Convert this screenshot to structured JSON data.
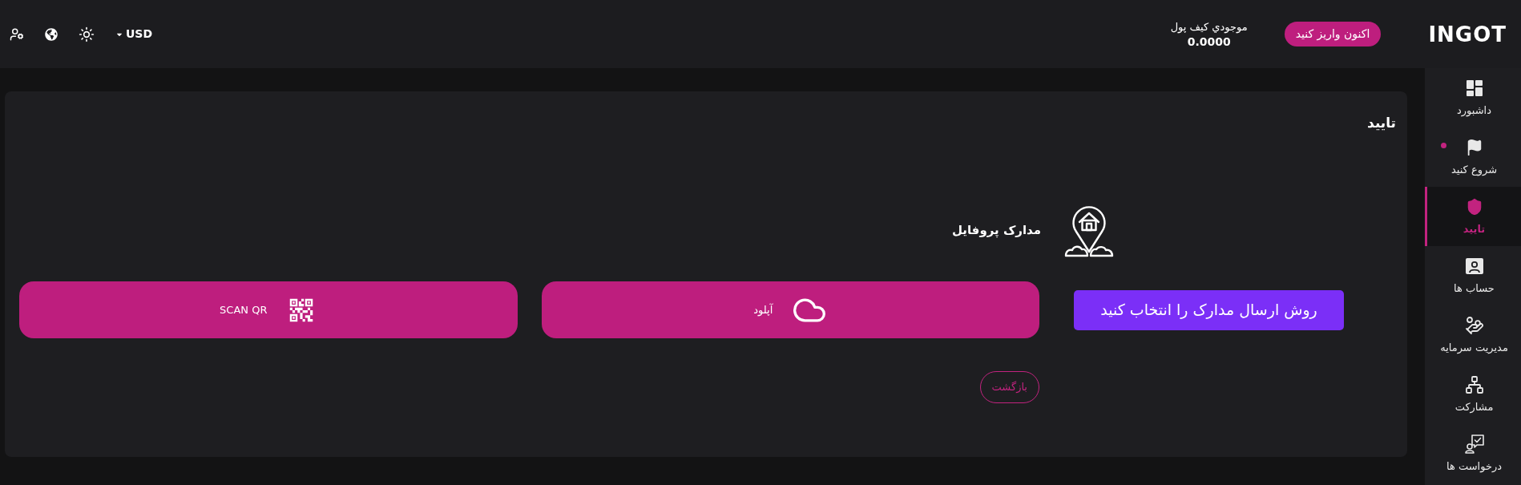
{
  "topbar": {
    "logo": "INGOT",
    "deposit_button": "اکنون واریز کنید",
    "wallet": {
      "label": "موجودي کیف پول",
      "balance": "0.0000"
    },
    "currency": "USD"
  },
  "sidebar": {
    "items": [
      {
        "label": "داشبورد",
        "selected": false,
        "dot": false
      },
      {
        "label": "شروع کنید",
        "selected": false,
        "dot": true
      },
      {
        "label": "تایید",
        "selected": true,
        "dot": false
      },
      {
        "label": "حساب ها",
        "selected": false,
        "dot": false
      },
      {
        "label": "مدیریت سرمایه",
        "selected": false,
        "dot": false
      },
      {
        "label": "مشارکت",
        "selected": false,
        "dot": false
      },
      {
        "label": "درخواست ها",
        "selected": false,
        "dot": false
      }
    ]
  },
  "page": {
    "title": "تایید",
    "section_title": "مدارک پروفایل",
    "callout": "روش ارسال مدارک را انتخاب کنید",
    "options": [
      {
        "label": "آپلود",
        "kind": "upload"
      },
      {
        "label": "SCAN QR",
        "kind": "qr"
      }
    ],
    "back_button": "بازگشت"
  }
}
